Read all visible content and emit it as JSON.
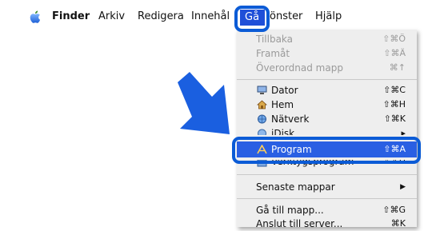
{
  "menubar": {
    "finder": "Finder",
    "arkiv": "Arkiv",
    "redigera": "Redigera",
    "innehall": "Innehål",
    "ga": "Gå",
    "fonster": "önster",
    "hjalp": "Hjälp"
  },
  "menu": {
    "tillbaka": {
      "label": "Tillbaka",
      "shortcut": "⇧⌘Ö"
    },
    "framat": {
      "label": "Framåt",
      "shortcut": "⇧⌘Ä"
    },
    "overordnad": {
      "label": "Överordnad mapp",
      "shortcut": "⌘↑"
    },
    "dator": {
      "label": "Dator",
      "shortcut": "⇧⌘C"
    },
    "hem": {
      "label": "Hem",
      "shortcut": "⇧⌘H"
    },
    "natverk": {
      "label": "Nätverk",
      "shortcut": "⇧⌘K"
    },
    "idisk": {
      "label": "iDisk"
    },
    "program": {
      "label": "Program",
      "shortcut": "⇧⌘A"
    },
    "verktyg": {
      "label": "Verktygsprogram",
      "shortcut": "⇧⌘U"
    },
    "senaste": {
      "label": "Senaste mappar"
    },
    "ga_till": {
      "label": "Gå till mapp...",
      "shortcut": "⇧⌘G"
    },
    "anslut": {
      "label": "Anslut till server...",
      "shortcut": "⌘K"
    }
  },
  "colors": {
    "highlight": "#2a5fe3",
    "ring": "#0b5bd6",
    "arrow": "#1a5fe0"
  }
}
